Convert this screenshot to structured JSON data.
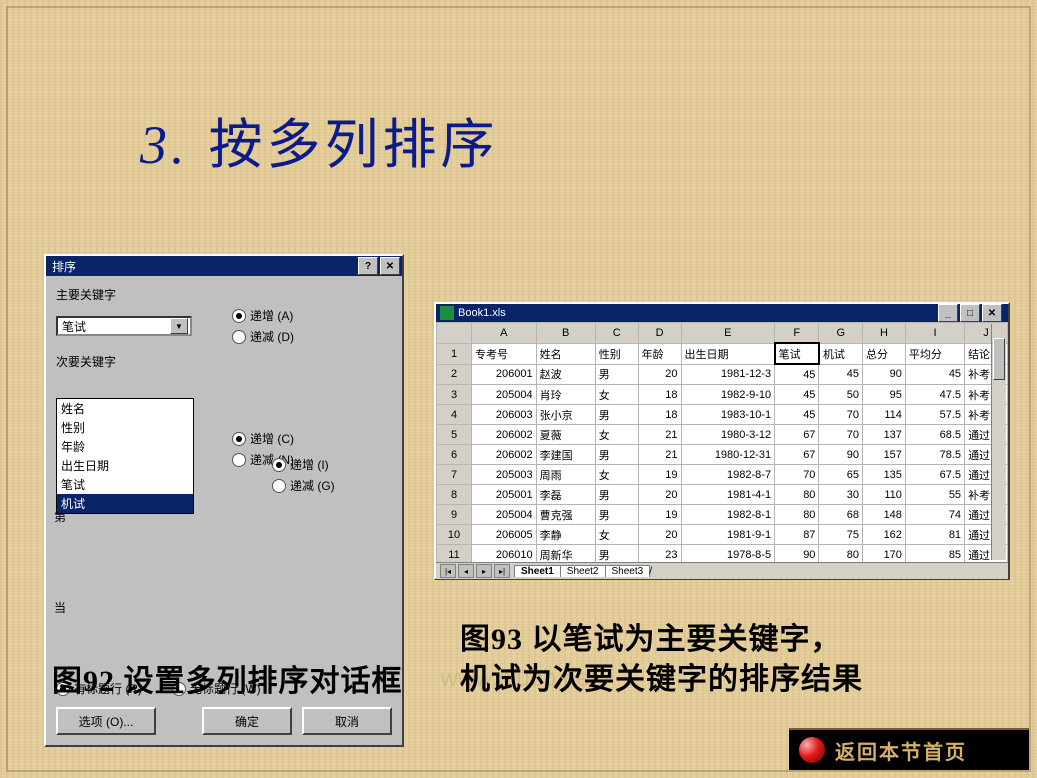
{
  "title": {
    "number": "3.",
    "text": "按多列排序"
  },
  "dialog": {
    "title": "排序",
    "primary_label": "主要关键字",
    "primary_value": "笔试",
    "asc1": "递增 (A)",
    "desc1": "递减 (D)",
    "secondary_label": "次要关键字",
    "asc2": "递增 (C)",
    "desc2": "递减 (N)",
    "asc3": "递增 (I)",
    "desc3": "递减 (G)",
    "options": [
      "姓名",
      "性别",
      "年龄",
      "出生日期",
      "笔试",
      "机试"
    ],
    "left_edge1": "第",
    "left_edge2": "当",
    "has_header": "有标题行 (R)",
    "no_header": "无标题行 (W)",
    "options_btn": "选项 (O)...",
    "ok_btn": "确定",
    "cancel_btn": "取消"
  },
  "sheet": {
    "window_title": "Book1.xls",
    "tabs": [
      "Sheet1",
      "Sheet2",
      "Sheet3"
    ],
    "col_letters": [
      "",
      "A",
      "B",
      "C",
      "D",
      "E",
      "F",
      "G",
      "H",
      "I",
      "J"
    ],
    "headers": [
      "专考号",
      "姓名",
      "性别",
      "年龄",
      "出生日期",
      "笔试",
      "机试",
      "总分",
      "平均分",
      "结论"
    ],
    "rows": [
      [
        "206001",
        "赵波",
        "男",
        "20",
        "1981-12-3",
        "45",
        "45",
        "90",
        "45",
        "补考"
      ],
      [
        "205004",
        "肖玲",
        "女",
        "18",
        "1982-9-10",
        "45",
        "50",
        "95",
        "47.5",
        "补考"
      ],
      [
        "206003",
        "张小京",
        "男",
        "18",
        "1983-10-1",
        "45",
        "70",
        "114",
        "57.5",
        "补考"
      ],
      [
        "206002",
        "夏薇",
        "女",
        "21",
        "1980-3-12",
        "67",
        "70",
        "137",
        "68.5",
        "通过"
      ],
      [
        "206002",
        "李建国",
        "男",
        "21",
        "1980-12-31",
        "67",
        "90",
        "157",
        "78.5",
        "通过"
      ],
      [
        "205003",
        "周雨",
        "女",
        "19",
        "1982-8-7",
        "70",
        "65",
        "135",
        "67.5",
        "通过"
      ],
      [
        "205001",
        "李磊",
        "男",
        "20",
        "1981-4-1",
        "80",
        "30",
        "110",
        "55",
        "补考"
      ],
      [
        "205004",
        "曹克强",
        "男",
        "19",
        "1982-8-1",
        "80",
        "68",
        "148",
        "74",
        "通过"
      ],
      [
        "206005",
        "李静",
        "女",
        "20",
        "1981-9-1",
        "87",
        "75",
        "162",
        "81",
        "通过"
      ],
      [
        "206010",
        "周新华",
        "男",
        "23",
        "1978-8-5",
        "90",
        "80",
        "170",
        "85",
        "通过"
      ]
    ]
  },
  "captions": {
    "fig92": "图92  设置多列排序对话框",
    "fig93a": "图93  以笔试为主要关键字，",
    "fig93b": "机试为次要关键字的排序结果"
  },
  "badge": {
    "label": "返回本节首页"
  },
  "watermark": "www.niubb.net"
}
